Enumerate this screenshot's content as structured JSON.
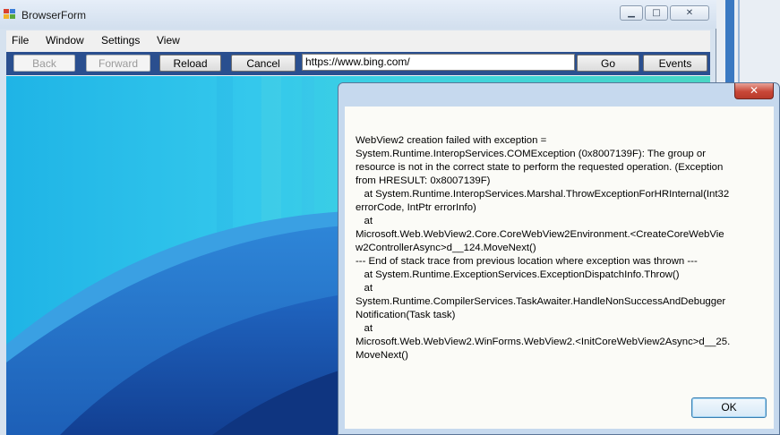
{
  "window": {
    "title": "BrowserForm",
    "minimize_glyph": "▁",
    "maximize_glyph": "□",
    "close_glyph": "✕"
  },
  "menu": [
    "File",
    "Window",
    "Settings",
    "View"
  ],
  "toolbar": {
    "back_label": "Back",
    "forward_label": "Forward",
    "reload_label": "Reload",
    "cancel_label": "Cancel",
    "address_value": "https://www.bing.com/",
    "go_label": "Go",
    "events_label": "Events"
  },
  "dialog": {
    "close_glyph": "✕",
    "message": "WebView2 creation failed with exception =\nSystem.Runtime.InteropServices.COMException (0x8007139F): The group or\nresource is not in the correct state to perform the requested operation. (Exception\nfrom HRESULT: 0x8007139F)\n   at System.Runtime.InteropServices.Marshal.ThrowExceptionForHRInternal(Int32\nerrorCode, IntPtr errorInfo)\n   at\nMicrosoft.Web.WebView2.Core.CoreWebView2Environment.<CreateCoreWebVie\nw2ControllerAsync>d__124.MoveNext()\n--- End of stack trace from previous location where exception was thrown ---\n   at System.Runtime.ExceptionServices.ExceptionDispatchInfo.Throw()\n   at\nSystem.Runtime.CompilerServices.TaskAwaiter.HandleNonSuccessAndDebugger\nNotification(Task task)\n   at\nMicrosoft.Web.WebView2.WinForms.WebView2.<InitCoreWebView2Async>d__25.\nMoveNext()",
    "ok_label": "OK"
  },
  "colors": {
    "toolbar_bg": "#2a4f8f",
    "dialog_frame": "#c6d9ee",
    "close_button": "#c84737"
  }
}
